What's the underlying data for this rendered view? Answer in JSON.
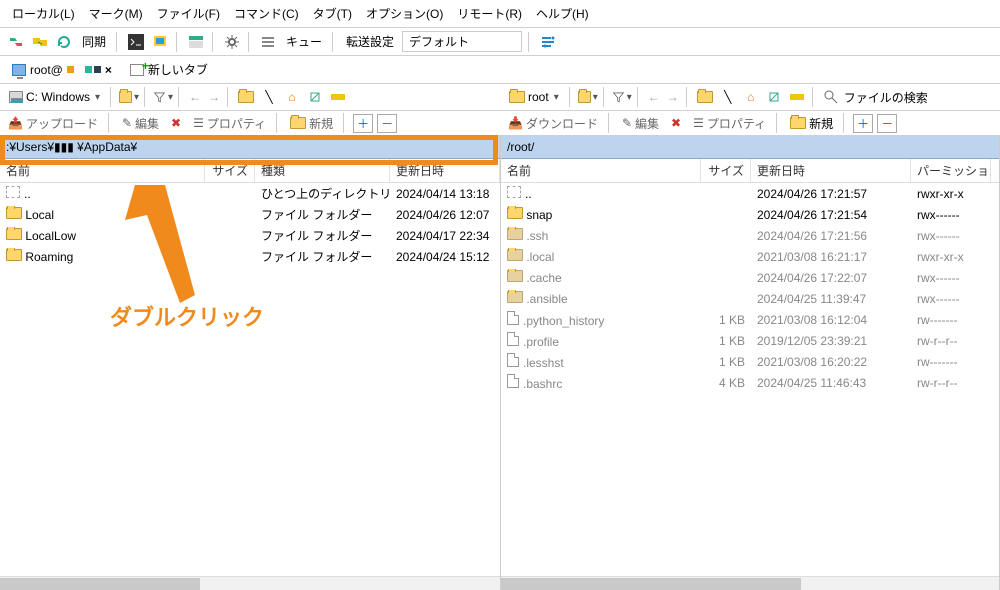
{
  "menu": {
    "local": "ローカル(L)",
    "mark": "マーク(M)",
    "file": "ファイル(F)",
    "command": "コマンド(C)",
    "tab": "タブ(T)",
    "option": "オプション(O)",
    "remote": "リモート(R)",
    "help": "ヘルプ(H)"
  },
  "toolbar": {
    "sync": "同期",
    "queue": "キュー",
    "transfer_label": "転送設定",
    "transfer_preset": "デフォルト"
  },
  "tabs": {
    "session": "root@",
    "newtab": "新しいタブ"
  },
  "local_tools": {
    "drive": "C: Windows"
  },
  "remote_tools": {
    "dir": "root",
    "find": "ファイルの検索"
  },
  "ops": {
    "upload": "アップロード",
    "download": "ダウンロード",
    "edit": "編集",
    "props": "プロパティ",
    "new": "新規"
  },
  "local": {
    "path": ":¥Users¥▮▮▮    ¥AppData¥",
    "cols": {
      "name": "名前",
      "size": "サイズ",
      "type": "種類",
      "date": "更新日時"
    },
    "parent_type": "ひとつ上のディレクトリ",
    "parent_date": "2024/04/14 13:18",
    "rows": [
      {
        "name": "Local",
        "type": "ファイル フォルダー",
        "date": "2024/04/26 12:07"
      },
      {
        "name": "LocalLow",
        "type": "ファイル フォルダー",
        "date": "2024/04/17 22:34"
      },
      {
        "name": "Roaming",
        "type": "ファイル フォルダー",
        "date": "2024/04/24 15:12"
      }
    ]
  },
  "remote": {
    "path": "/root/",
    "cols": {
      "name": "名前",
      "size": "サイズ",
      "date": "更新日時",
      "perm": "パーミッション"
    },
    "parent_date": "2024/04/26 17:21:57",
    "parent_perm": "rwxr-xr-x",
    "rows": [
      {
        "t": "d",
        "name": "snap",
        "size": "",
        "date": "2024/04/26 17:21:54",
        "perm": "rwx------"
      },
      {
        "t": "d",
        "dim": true,
        "name": ".ssh",
        "size": "",
        "date": "2024/04/26 17:21:56",
        "perm": "rwx------"
      },
      {
        "t": "d",
        "dim": true,
        "name": ".local",
        "size": "",
        "date": "2021/03/08 16:21:17",
        "perm": "rwxr-xr-x"
      },
      {
        "t": "d",
        "dim": true,
        "name": ".cache",
        "size": "",
        "date": "2024/04/26 17:22:07",
        "perm": "rwx------"
      },
      {
        "t": "d",
        "dim": true,
        "name": ".ansible",
        "size": "",
        "date": "2024/04/25 11:39:47",
        "perm": "rwx------"
      },
      {
        "t": "f",
        "dim": true,
        "name": ".python_history",
        "size": "1 KB",
        "date": "2021/03/08 16:12:04",
        "perm": "rw-------"
      },
      {
        "t": "f",
        "dim": true,
        "name": ".profile",
        "size": "1 KB",
        "date": "2019/12/05 23:39:21",
        "perm": "rw-r--r--"
      },
      {
        "t": "f",
        "dim": true,
        "name": ".lesshst",
        "size": "1 KB",
        "date": "2021/03/08 16:20:22",
        "perm": "rw-------"
      },
      {
        "t": "f",
        "dim": true,
        "name": ".bashrc",
        "size": "4 KB",
        "date": "2024/04/25 11:46:43",
        "perm": "rw-r--r--"
      }
    ]
  },
  "annotation": {
    "text": "ダブルクリック"
  }
}
